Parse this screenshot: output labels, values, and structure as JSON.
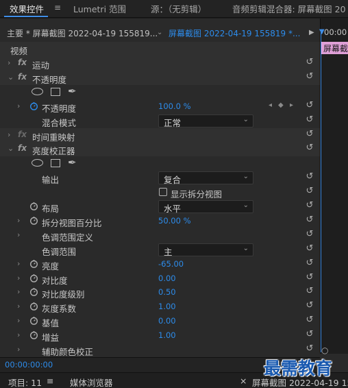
{
  "tabs": [
    {
      "label": "效果控件",
      "active": true
    },
    {
      "label": "Lumetri 范围"
    },
    {
      "label": "源：（无剪辑）"
    },
    {
      "label": "音频剪辑混合器: 屏幕截图 20"
    }
  ],
  "tab_menu_icon": "≡",
  "sequence_bar": {
    "master_label": "主要 * 屏幕截图 2022-04-19 155819...",
    "clip_label": "屏幕截图 2022-04-19 155819 *...",
    "play_icon": "▶",
    "ruler_time": "00:00",
    "clip_bar_label": "屏幕截图"
  },
  "section_header": "视频",
  "rows": [
    {
      "type": "group",
      "expanded": false,
      "fx": true,
      "label": "运动"
    },
    {
      "type": "group",
      "expanded": true,
      "fx": true,
      "label": "不透明度"
    },
    {
      "type": "masks"
    },
    {
      "type": "param",
      "chev": true,
      "stopwatch": "blue",
      "label": "不透明度",
      "value": "100.0 %",
      "keyframes": true
    },
    {
      "type": "select",
      "label": "混合模式",
      "value": "正常"
    },
    {
      "type": "group",
      "expanded": false,
      "fx": true,
      "fx_dim": true,
      "label": "时间重映射"
    },
    {
      "type": "group",
      "expanded": true,
      "fx": true,
      "label": "亮度校正器"
    },
    {
      "type": "masks"
    },
    {
      "type": "select",
      "label": "输出",
      "value": "复合"
    },
    {
      "type": "checkbox",
      "label": "显示拆分视图"
    },
    {
      "type": "select",
      "stopwatch": "grey",
      "label": "布局",
      "value": "水平"
    },
    {
      "type": "param",
      "chev": true,
      "stopwatch": "grey",
      "label": "拆分视图百分比",
      "value": "50.00 %"
    },
    {
      "type": "param",
      "chev": true,
      "label": "色调范围定义",
      "value": ""
    },
    {
      "type": "select",
      "label": "色调范围",
      "value": "主"
    },
    {
      "type": "param",
      "chev": true,
      "stopwatch": "grey",
      "label": "亮度",
      "value": "-65.00"
    },
    {
      "type": "param",
      "chev": true,
      "stopwatch": "grey",
      "label": "对比度",
      "value": "0.00"
    },
    {
      "type": "param",
      "chev": true,
      "stopwatch": "grey",
      "label": "对比度级别",
      "value": "0.50"
    },
    {
      "type": "param",
      "chev": true,
      "stopwatch": "grey",
      "label": "灰度系数",
      "value": "1.00"
    },
    {
      "type": "param",
      "chev": true,
      "stopwatch": "grey",
      "label": "基值",
      "value": "0.00"
    },
    {
      "type": "param",
      "chev": true,
      "stopwatch": "grey",
      "label": "增益",
      "value": "1.00"
    },
    {
      "type": "param",
      "chev": true,
      "label": "辅助颜色校正",
      "value": ""
    }
  ],
  "reset_icon": "↺",
  "bottom_timecode": "00:00:00:00",
  "bottom_tabs": [
    {
      "label": "项目: 11"
    },
    {
      "label": "≡"
    },
    {
      "label": "媒体浏览器"
    },
    {
      "label": "×"
    },
    {
      "label": "屏幕截图 2022-04-19 1558"
    }
  ],
  "watermark": "最需教育",
  "colors": {
    "accent": "#3f8ee8",
    "value_blue": "#2d8ceb",
    "clip_pink": "#e0a0d8"
  }
}
